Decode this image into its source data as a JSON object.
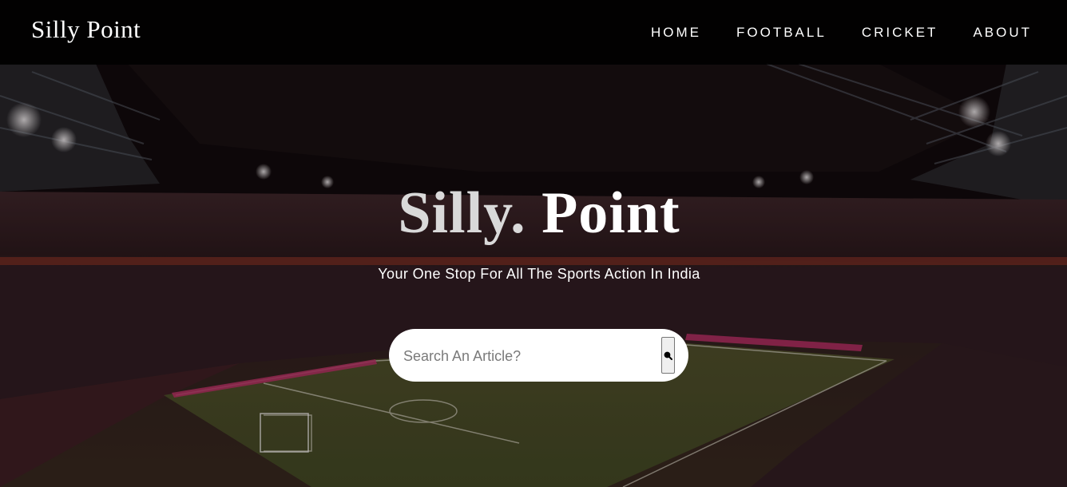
{
  "navbar": {
    "brand": "Silly Point",
    "links": [
      {
        "label": "HOME"
      },
      {
        "label": "FOOTBALL"
      },
      {
        "label": "CRICKET"
      },
      {
        "label": "ABOUT"
      }
    ]
  },
  "hero": {
    "title_part1": "Silly.",
    "title_part2": " Point",
    "subtitle": "Your One Stop For All The Sports Action In India"
  },
  "search": {
    "placeholder": "Search An Article?",
    "value": "",
    "button_icon": "search-icon"
  },
  "colors": {
    "navbar_bg": "#000000",
    "text": "#ffffff",
    "search_bg": "#ffffff",
    "pitch": "#4a5a2a",
    "ad_boards": "#c0306a"
  }
}
